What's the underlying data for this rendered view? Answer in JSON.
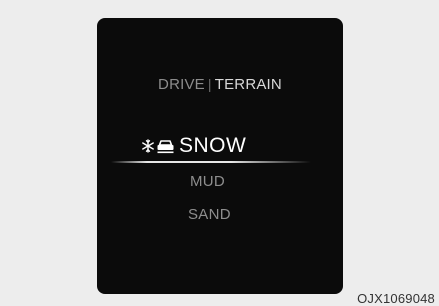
{
  "display": {
    "header": {
      "drive_label": "DRIVE",
      "separator": "|",
      "terrain_label": "TERRAIN"
    },
    "modes": [
      {
        "label": "SNOW",
        "selected": true,
        "icons": [
          "snowflake-icon",
          "car-icon"
        ]
      },
      {
        "label": "MUD",
        "selected": false
      },
      {
        "label": "SAND",
        "selected": false
      }
    ]
  },
  "image_code": "OJX1069048",
  "colors": {
    "screen_background": "#0b0b0b",
    "page_background": "#ededed",
    "selected_text": "#ffffff",
    "unselected_text": "#8e8e8e"
  }
}
